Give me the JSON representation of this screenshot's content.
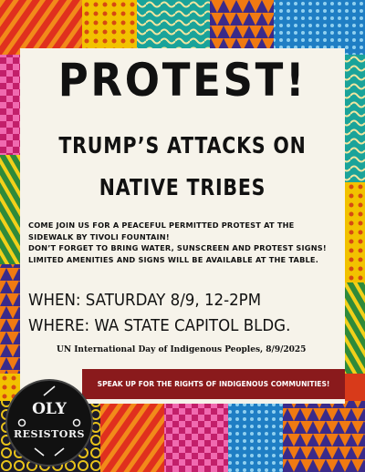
{
  "poster": {
    "headline": "PROTEST!",
    "subhead_line1": "TRUMP’S ATTACKS ON",
    "subhead_line2": "NATIVE TRIBES",
    "body": [
      "COME JOIN US FOR A PEACEFUL PERMITTED PROTEST AT THE",
      "SIDEWALK BY TIVOLI FOUNTAIN!",
      "DON’T FORGET TO BRING WATER, SUNSCREEN AND PROTEST SIGNS!",
      "LIMITED AMENITIES AND SIGNS WILL BE AVAILABLE AT THE TABLE."
    ],
    "when": "WHEN: SATURDAY 8/9, 12-2PM",
    "where": "WHERE: WA STATE CAPITOL BLDG.",
    "occasion": "UN International Day of Indigenous Peoples, 8/9/2025",
    "banner": "SPEAK UP FOR THE RIGHTS OF INDIGENOUS COMMUNITIES!",
    "logo_top": "OLY",
    "logo_bottom": "RESISTORS"
  },
  "colors": {
    "panel": "#f6f3ea",
    "banner": "#8a1a1c",
    "logo_bg": "#111111"
  }
}
